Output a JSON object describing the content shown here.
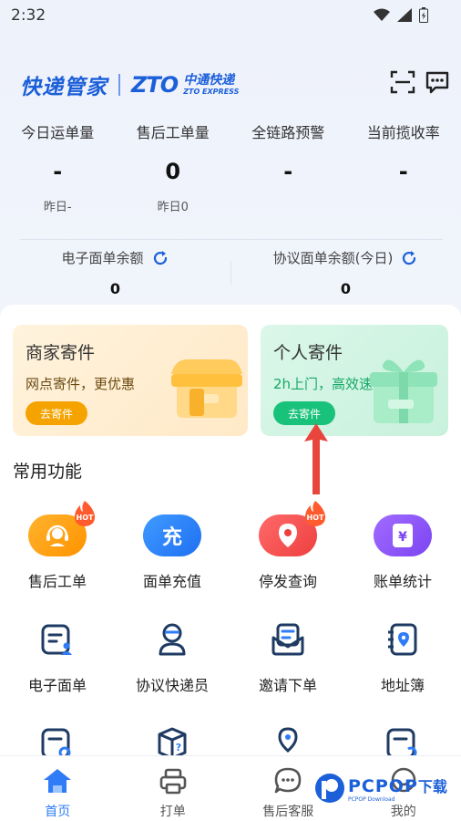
{
  "status": {
    "time": "2:32"
  },
  "brand": {
    "name": "快递管家",
    "zto_logo": "ZTO",
    "zto_cn": "中通快递",
    "zto_en": "ZTO EXPRESS"
  },
  "header_icons": [
    "scan-icon",
    "message-icon"
  ],
  "stats": [
    {
      "label": "今日运单量",
      "value": "-",
      "sub": "昨日-"
    },
    {
      "label": "售后工单量",
      "value": "0",
      "sub": "昨日0"
    },
    {
      "label": "全链路预警",
      "value": "-",
      "sub": ""
    },
    {
      "label": "当前揽收率",
      "value": "-",
      "sub": ""
    }
  ],
  "balances": [
    {
      "label": "电子面单余额",
      "value": "0"
    },
    {
      "label": "协议面单余额(今日)",
      "value": "0"
    }
  ],
  "cards": {
    "merchant": {
      "title": "商家寄件",
      "subtitle": "网点寄件，更优惠",
      "button": "去寄件"
    },
    "personal": {
      "title": "个人寄件",
      "subtitle": "2h上门，高效速达",
      "button": "去寄件"
    }
  },
  "common_functions": {
    "title": "常用功能",
    "hot_label": "HOT",
    "items": [
      {
        "label": "售后工单",
        "icon": "headset-icon"
      },
      {
        "label": "面单充值",
        "icon": "recharge-icon",
        "glyph": "充"
      },
      {
        "label": "停发查询",
        "icon": "location-search-icon"
      },
      {
        "label": "账单统计",
        "icon": "bill-icon"
      },
      {
        "label": "电子面单",
        "icon": "waybill-user-icon"
      },
      {
        "label": "协议快递员",
        "icon": "courier-icon"
      },
      {
        "label": "邀请下单",
        "icon": "invite-icon"
      },
      {
        "label": "地址簿",
        "icon": "address-book-icon"
      }
    ]
  },
  "tabs": [
    {
      "label": "首页",
      "icon": "home-icon",
      "active": true
    },
    {
      "label": "打单",
      "icon": "printer-icon",
      "active": false
    },
    {
      "label": "售后客服",
      "icon": "chat-icon",
      "active": false
    },
    {
      "label": "我的",
      "icon": "profile-icon",
      "active": false
    }
  ],
  "watermark": {
    "brand": "PCPOP",
    "cn": "下载",
    "small": "PCPOP Download"
  },
  "colors": {
    "brand_blue": "#1b5fd9",
    "merchant_btn": "#f5a300",
    "personal_btn": "#19c27a",
    "arrow": "#e8453c"
  }
}
